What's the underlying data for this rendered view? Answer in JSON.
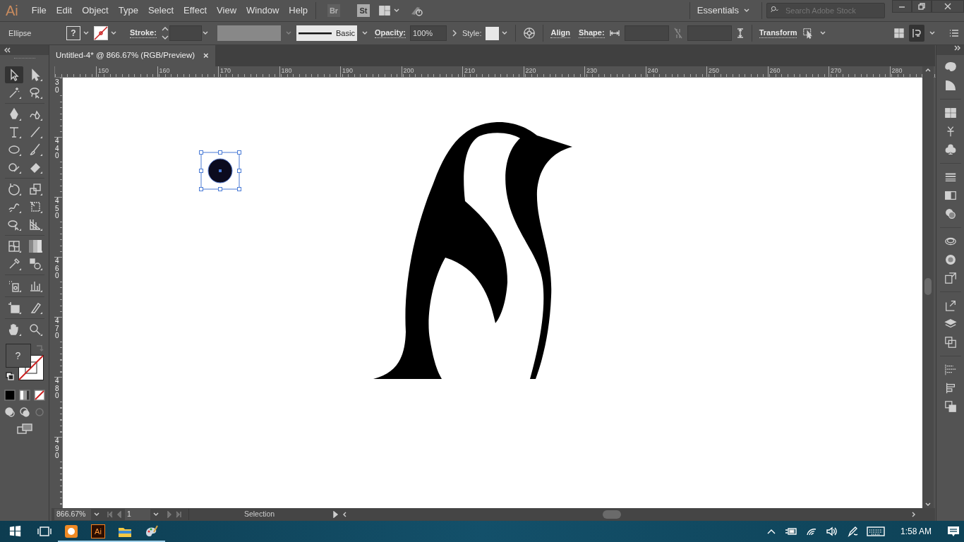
{
  "app_logo": "Ai",
  "menu": [
    "File",
    "Edit",
    "Object",
    "Type",
    "Select",
    "Effect",
    "View",
    "Window",
    "Help"
  ],
  "bridge_buttons": [
    {
      "label": "Br",
      "disabled": true
    },
    {
      "label": "St",
      "disabled": false
    }
  ],
  "workspace": "Essentials",
  "search": {
    "placeholder": "Search Adobe Stock"
  },
  "control_bar": {
    "selection": "Ellipse",
    "fill": "?",
    "stroke_label": "Stroke:",
    "brush": "Basic",
    "opacity_label": "Opacity:",
    "opacity": "100%",
    "style_label": "Style:",
    "align": "Align",
    "shape_label": "Shape:",
    "transform": "Transform"
  },
  "document_tab": {
    "title": "Untitled-4* @ 866.67% (RGB/Preview)",
    "close": "×"
  },
  "tools": [
    {
      "kind": "selection",
      "selected": true
    },
    {
      "kind": "direct-selection",
      "selected": false
    },
    {
      "kind": "magic-wand",
      "selected": false
    },
    {
      "kind": "lasso",
      "selected": false
    },
    {
      "kind": "pen",
      "selected": false
    },
    {
      "kind": "curvature",
      "selected": false
    },
    {
      "kind": "type",
      "selected": false
    },
    {
      "kind": "line",
      "selected": false
    },
    {
      "kind": "ellipse",
      "selected": false
    },
    {
      "kind": "paintbrush",
      "selected": false
    },
    {
      "kind": "shaper",
      "selected": false
    },
    {
      "kind": "eraser",
      "selected": false
    },
    {
      "kind": "rotate",
      "selected": false
    },
    {
      "kind": "scale",
      "selected": false
    },
    {
      "kind": "warp",
      "selected": false
    },
    {
      "kind": "free-transform",
      "selected": false
    },
    {
      "kind": "shape-builder",
      "selected": false
    },
    {
      "kind": "perspective",
      "selected": false
    },
    {
      "kind": "mesh",
      "selected": false
    },
    {
      "kind": "gradient",
      "selected": false
    },
    {
      "kind": "eyedropper",
      "selected": false
    },
    {
      "kind": "blend",
      "selected": false
    },
    {
      "kind": "symbol-sprayer",
      "selected": false
    },
    {
      "kind": "graph",
      "selected": false
    },
    {
      "kind": "artboard",
      "selected": false
    },
    {
      "kind": "slice",
      "selected": false
    },
    {
      "kind": "hand",
      "selected": false
    },
    {
      "kind": "zoom",
      "selected": false
    }
  ],
  "fill_stroke": {
    "fill": "?"
  },
  "ruler": {
    "x_labels": [
      "150",
      "160",
      "170",
      "180",
      "190",
      "200",
      "210",
      "220",
      "230",
      "240",
      "250",
      "260",
      "270",
      "280"
    ],
    "y_labels": [
      "30",
      "440",
      "450",
      "460",
      "470",
      "480",
      "490"
    ]
  },
  "status_bar": {
    "zoom": "866.67%",
    "artboard": "1",
    "tool": "Selection"
  },
  "taskbar": {
    "apps": [
      {
        "kind": "browser",
        "running": true
      },
      {
        "kind": "illustrator",
        "label": "Ai",
        "running": true
      },
      {
        "kind": "folder",
        "running": true
      },
      {
        "kind": "paint",
        "running": true
      }
    ],
    "time": "1:58 AM"
  }
}
